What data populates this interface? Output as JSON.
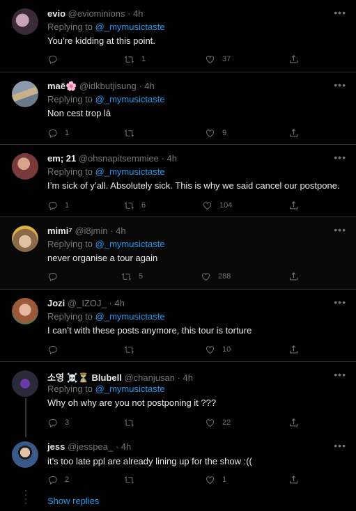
{
  "tweets": [
    {
      "name": "evio",
      "badge": "",
      "handle": "@eviominions",
      "time": "4h",
      "reply_prefix": "Replying to",
      "mention": "@_mymusictaste",
      "text": "You’re kidding at this point.",
      "replies": "",
      "retweets": "1",
      "likes": "37",
      "avatar_color": "#3a2a3a"
    },
    {
      "name": "maë",
      "badge": "🌸",
      "handle": "@idkbutjisung",
      "time": "4h",
      "reply_prefix": "Replying to",
      "mention": "@_mymusictaste",
      "text": "Non cest trop là",
      "replies": "1",
      "retweets": "",
      "likes": "9",
      "avatar_color": "#6b7a8a"
    },
    {
      "name": "em; 21",
      "badge": "",
      "handle": "@ohsnapitsemmiee",
      "time": "4h",
      "reply_prefix": "Replying to",
      "mention": "@_mymusictaste",
      "text": "I’m sick of y’all. Absolutely sick. This is why we said cancel our postpone.",
      "replies": "1",
      "retweets": "6",
      "likes": "104",
      "avatar_color": "#7a3a3a"
    },
    {
      "name": "mimi⁷",
      "badge": "",
      "handle": "@i8jmin",
      "time": "4h",
      "reply_prefix": "Replying to",
      "mention": "@_mymusictaste",
      "text": "never organise a tour again",
      "replies": "",
      "retweets": "5",
      "likes": "288",
      "avatar_color": "#8a6a4a"
    },
    {
      "name": "Jozi",
      "badge": "",
      "handle": "@_IZOJ_",
      "time": "4h",
      "reply_prefix": "Replying to",
      "mention": "@_mymusictaste",
      "text": "I can’t with these posts anymore, this tour is torture",
      "replies": "",
      "retweets": "",
      "likes": "10",
      "avatar_color": "#9a5a3a"
    },
    {
      "name": "소영 ☠️⏳ Blubell",
      "badge": "",
      "handle": "@chanjusan",
      "time": "4h",
      "reply_prefix": "Replying to",
      "mention": "@_mymusictaste",
      "text": "Why oh why are you not postponing it ???",
      "replies": "3",
      "retweets": "",
      "likes": "22",
      "avatar_color": "#2a2a3a"
    },
    {
      "name": "jess",
      "badge": "",
      "handle": "@jesspea_",
      "time": "4h",
      "reply_prefix": "",
      "mention": "",
      "text": "it’s too late ppl are already lining up for the show :((",
      "replies": "2",
      "retweets": "",
      "likes": "1",
      "avatar_color": "#3a5a8a"
    }
  ],
  "separator": "·",
  "show_replies": "Show replies",
  "colors": {
    "accent": "#1d9bf0",
    "muted": "#71767b",
    "background": "#000000",
    "border": "#2f3336"
  }
}
